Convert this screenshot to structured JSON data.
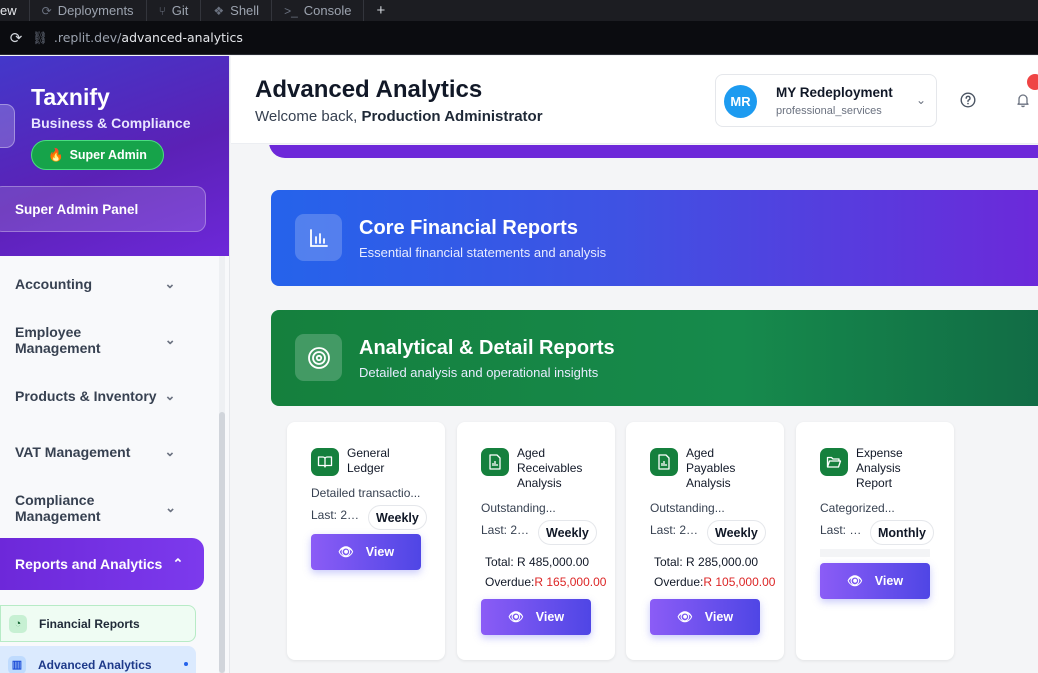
{
  "browser": {
    "tabs": [
      {
        "label": "ew"
      },
      {
        "label": "Deployments",
        "icon": "deployments-icon"
      },
      {
        "label": "Git",
        "icon": "git-icon"
      },
      {
        "label": "Shell",
        "icon": "shell-icon"
      },
      {
        "label": "Console",
        "icon": "console-icon"
      }
    ],
    "new_tab": "+",
    "url_domain": ".replit.dev/",
    "url_path": "advanced-analytics"
  },
  "sidebar": {
    "brand": "Taxnify",
    "subtitle": "Business & Compliance",
    "role_badge": "Super Admin",
    "panel_label": "Super Admin Panel",
    "nav": [
      {
        "label": "Accounting",
        "expanded": false
      },
      {
        "label": "Employee Management",
        "expanded": false
      },
      {
        "label": "Products & Inventory",
        "expanded": false
      },
      {
        "label": "VAT Management",
        "expanded": false
      },
      {
        "label": "Compliance Management",
        "expanded": false
      },
      {
        "label": "Reports and Analytics",
        "expanded": true
      }
    ],
    "sub_items": [
      {
        "label": "Financial Reports",
        "icon": "pie-chart-icon"
      },
      {
        "label": "Advanced Analytics",
        "icon": "bar-chart-icon",
        "active": true
      }
    ]
  },
  "header": {
    "title": "Advanced Analytics",
    "welcome_prefix": "Welcome back, ",
    "user_name": "Production Administrator",
    "org": {
      "initials": "MR",
      "name": "MY Redeployment",
      "type": "professional_services"
    }
  },
  "banners": [
    {
      "title": "Core Financial Reports",
      "subtitle": "Essential financial statements and analysis",
      "icon": "bar-chart-icon"
    },
    {
      "title": "Analytical & Detail Reports",
      "subtitle": "Detailed analysis and operational insights",
      "icon": "target-icon"
    }
  ],
  "cards": [
    {
      "title": "General Ledger",
      "desc": "Detailed transactio...",
      "last": "Last: 20...",
      "freq": "Weekly",
      "view": "View",
      "icon": "book-icon"
    },
    {
      "title": "Aged Receivables Analysis",
      "desc": "Outstanding...",
      "last": "Last: 20...",
      "freq": "Weekly",
      "total_label": "Total: ",
      "total": "R 485,000.00",
      "overdue_label": "Overdue:",
      "overdue": "R 165,000.00",
      "view": "View",
      "icon": "file-chart-icon"
    },
    {
      "title": "Aged Payables Analysis",
      "desc": "Outstanding...",
      "last": "Last: 20...",
      "freq": "Weekly",
      "total_label": "Total: ",
      "total": "R 285,000.00",
      "overdue_label": "Overdue:",
      "overdue": "R 105,000.00",
      "view": "View",
      "icon": "file-chart-icon"
    },
    {
      "title": "Expense Analysis Report",
      "desc": "Categorized...",
      "last": "Last: 2...",
      "freq": "Monthly",
      "view": "View",
      "icon": "folder-open-icon"
    }
  ],
  "colors": {
    "brand_purple": "#5b21b6",
    "core_blue": "#2563eb",
    "analytical_green": "#15803d",
    "overdue_red": "#dc2626",
    "avatar_blue": "#1d9bf0"
  }
}
